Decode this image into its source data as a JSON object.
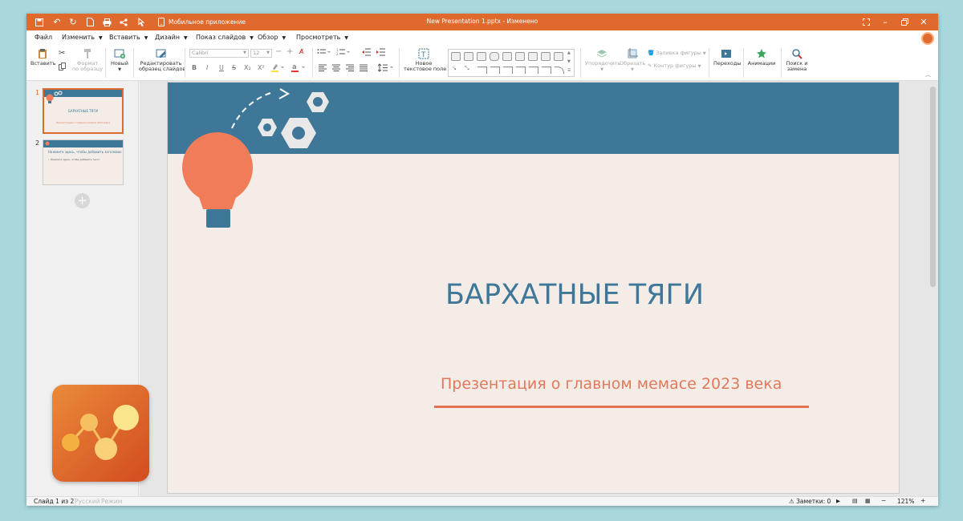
{
  "titlebar": {
    "mobile_app": "Мобильное приложение",
    "doc_title": "New Presentation 1.pptx - Изменено"
  },
  "menu": [
    "Файл",
    "Изменить",
    "Вставить",
    "Дизайн",
    "Показ слайдов",
    "Обзор",
    "Просмотреть"
  ],
  "ribbon": {
    "paste": "Вставить",
    "format_painter_1": "Формат",
    "format_painter_2": "по образцу",
    "new_slide": "Новый",
    "edit_master_1": "Редактировать",
    "edit_master_2": "образец слайдов",
    "font_name": "Calibri",
    "font_size": "12",
    "new_textbox_1": "Новое",
    "new_textbox_2": "текстовое поле",
    "arrange": "Упорядочить",
    "crop": "Обрезать",
    "shape_fill": "Заливка фигуры",
    "shape_outline": "Контур фигуры",
    "transitions": "Переходы",
    "animations": "Анимации",
    "find_replace_1": "Поиск и",
    "find_replace_2": "замена"
  },
  "slides_panel": {
    "slide1_num": "1",
    "slide1_title": "БАРХАТНЫЕ ТЯГИ",
    "slide1_subtitle": "Презентация о главном мемасе 2023 века",
    "slide2_num": "2",
    "slide2_title": "Нажмите здесь, чтобы добавить заголовок",
    "slide2_bullet": "• Нажмите здесь, чтобы добавить текст"
  },
  "slide": {
    "title": "БАРХАТНЫЕ ТЯГИ",
    "subtitle": "Презентация о главном мемасе 2023 века"
  },
  "status": {
    "slide_info": "Слайд 1 из 2",
    "language": "Русский",
    "mode": "Режим",
    "notes": "Заметки: 0",
    "zoom": "121%"
  },
  "colors": {
    "accent": "#e0692d",
    "banner": "#3f7799",
    "slide_bg": "#f4ede7",
    "bulb": "#f07c5a",
    "underline": "#e57353"
  }
}
